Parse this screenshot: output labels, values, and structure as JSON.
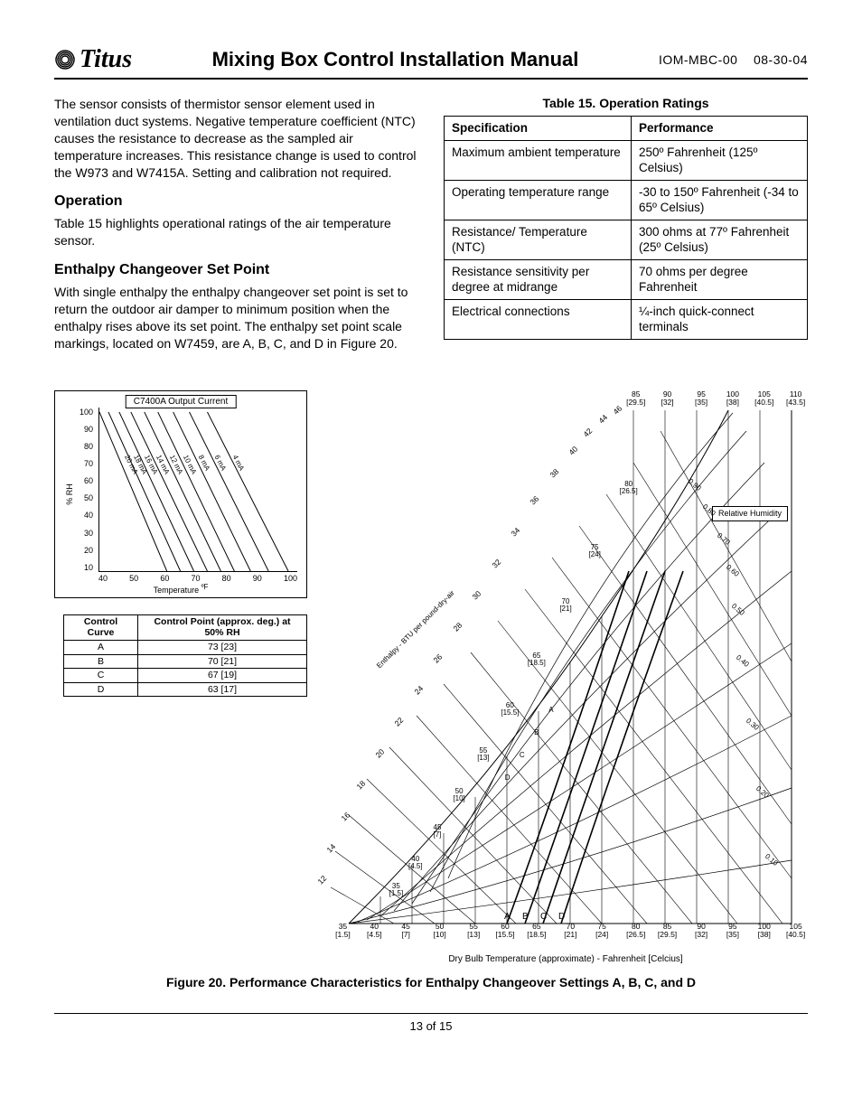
{
  "header": {
    "brand": "Titus",
    "title": "Mixing Box Control Installation Manual",
    "doc_num": "IOM-MBC-00",
    "date": "08-30-04"
  },
  "intro_para": "The sensor consists of thermistor sensor element used in ventilation duct systems. Negative temperature coefficient (NTC) causes the resistance to decrease as the sampled air temperature increases. This resistance change is used to control the W973 and W7415A. Setting and calibration not required.",
  "operation": {
    "heading": "Operation",
    "text": "Table 15 highlights operational ratings of the air temperature sensor."
  },
  "enthalpy": {
    "heading": "Enthalpy Changeover Set Point",
    "text": "With single enthalpy the enthalpy changeover set point is set to return the outdoor air damper to minimum position when the enthalpy rises above its set point. The enthalpy set point scale markings, located on W7459, are A, B, C, and D in Figure 20."
  },
  "table15": {
    "caption": "Table 15. Operation Ratings",
    "head": {
      "spec": "Specification",
      "perf": "Performance"
    },
    "rows": [
      {
        "spec": "Maximum ambient temperature",
        "perf": "250º Fahrenheit (125º Celsius)"
      },
      {
        "spec": "Operating temperature range",
        "perf": "-30 to 150º Fahrenheit (-34 to 65º Celsius)"
      },
      {
        "spec": "Resistance/ Temperature (NTC)",
        "perf": "300 ohms at 77º Fahrenheit (25º Celsius)"
      },
      {
        "spec": "Resistance sensitivity per degree at midrange",
        "perf": "70 ohms per degree Fahrenheit"
      },
      {
        "spec": "Electrical connections",
        "perf": "¼-inch quick-connect terminals"
      }
    ]
  },
  "control_curve_table": {
    "head": {
      "curve": "Control Curve",
      "point": "Control Point (approx. deg.) at 50% RH"
    },
    "rows": [
      {
        "curve": "A",
        "point": "73 [23]"
      },
      {
        "curve": "B",
        "point": "70 [21]"
      },
      {
        "curve": "C",
        "point": "67 [19]"
      },
      {
        "curve": "D",
        "point": "63 [17]"
      }
    ]
  },
  "mini_chart": {
    "title": "C7400A Output Current",
    "ylabel": "% RH",
    "xlabel": "Temperature",
    "xunit": "ºF",
    "y_ticks": [
      "100",
      "90",
      "80",
      "70",
      "60",
      "50",
      "40",
      "30",
      "20",
      "10"
    ],
    "x_ticks": [
      "40",
      "50",
      "60",
      "70",
      "80",
      "90",
      "100"
    ],
    "series_labels": [
      "20 mA",
      "18 mA",
      "16 mA",
      "14 mA",
      "12 mA",
      "10 mA",
      "8 mA",
      "6 mA",
      "4 mA"
    ]
  },
  "psych": {
    "rh_box": "Relative Humidity",
    "x_axis_label": "Dry Bulb Temperature (approximate) - Fahrenheit [Celcius]",
    "enthalpy_axis_label": "Enthalpy - BTU per pound-dry-air",
    "x_ticks": [
      {
        "f": "35",
        "c": "[1.5]"
      },
      {
        "f": "40",
        "c": "[4.5]"
      },
      {
        "f": "45",
        "c": "[7]"
      },
      {
        "f": "50",
        "c": "[10]"
      },
      {
        "f": "55",
        "c": "[13]"
      },
      {
        "f": "60",
        "c": "[15.5]"
      },
      {
        "f": "65",
        "c": "[18.5]"
      },
      {
        "f": "70",
        "c": "[21]"
      },
      {
        "f": "75",
        "c": "[24]"
      },
      {
        "f": "80",
        "c": "[26.5]"
      },
      {
        "f": "85",
        "c": "[29.5]"
      },
      {
        "f": "90",
        "c": "[32]"
      },
      {
        "f": "95",
        "c": "[35]"
      },
      {
        "f": "100",
        "c": "[38]"
      },
      {
        "f": "105",
        "c": "[40.5]"
      }
    ],
    "top_ticks": [
      {
        "f": "85",
        "c": "[29.5]"
      },
      {
        "f": "90",
        "c": "[32]"
      },
      {
        "f": "95",
        "c": "[35]"
      },
      {
        "f": "100",
        "c": "[38]"
      },
      {
        "f": "105",
        "c": "[40.5]"
      },
      {
        "f": "110",
        "c": "[43.5]"
      }
    ],
    "db_marks": [
      {
        "f": "80",
        "c": "[26.5]"
      },
      {
        "f": "75",
        "c": "[24]"
      },
      {
        "f": "70",
        "c": "[21]"
      },
      {
        "f": "65",
        "c": "[18.5]"
      },
      {
        "f": "60",
        "c": "[15.5]"
      },
      {
        "f": "55",
        "c": "[13]"
      },
      {
        "f": "50",
        "c": "[10]"
      },
      {
        "f": "45",
        "c": "[7]"
      },
      {
        "f": "40",
        "c": "[4.5]"
      },
      {
        "f": "35",
        "c": "[1.5]"
      }
    ],
    "enthalpy_ticks": [
      "12",
      "14",
      "16",
      "18",
      "20",
      "22",
      "24",
      "26",
      "28",
      "30",
      "32",
      "34",
      "36",
      "38",
      "40",
      "42",
      "44",
      "46"
    ],
    "rh_curves": [
      "0.10",
      "0.20",
      "0.30",
      "0.40",
      "0.50",
      "0.60",
      "0.70",
      "0.80",
      "0.90"
    ],
    "point_labels": [
      "A",
      "B",
      "C",
      "D"
    ]
  },
  "chart_data": [
    {
      "type": "line",
      "title": "C7400A Output Current",
      "xlabel": "Temperature ºF",
      "ylabel": "% RH",
      "xlim": [
        40,
        100
      ],
      "ylim": [
        10,
        100
      ],
      "note": "Approximate parallel iso-current lines descending from upper-left",
      "series": [
        {
          "name": "20 mA",
          "x": [
            40,
            60
          ],
          "y": [
            95,
            10
          ]
        },
        {
          "name": "18 mA",
          "x": [
            42,
            64
          ],
          "y": [
            95,
            10
          ]
        },
        {
          "name": "16 mA",
          "x": [
            45,
            68
          ],
          "y": [
            95,
            10
          ]
        },
        {
          "name": "14 mA",
          "x": [
            48,
            72
          ],
          "y": [
            95,
            10
          ]
        },
        {
          "name": "12 mA",
          "x": [
            52,
            76
          ],
          "y": [
            95,
            10
          ]
        },
        {
          "name": "10 mA",
          "x": [
            56,
            80
          ],
          "y": [
            95,
            10
          ]
        },
        {
          "name": "8 mA",
          "x": [
            60,
            85
          ],
          "y": [
            95,
            10
          ]
        },
        {
          "name": "6 mA",
          "x": [
            65,
            90
          ],
          "y": [
            95,
            10
          ]
        },
        {
          "name": "4 mA",
          "x": [
            70,
            95
          ],
          "y": [
            95,
            10
          ]
        }
      ]
    },
    {
      "type": "table",
      "title": "Control curve set points at 50% RH",
      "categories": [
        "A",
        "B",
        "C",
        "D"
      ],
      "values_F": [
        73,
        70,
        67,
        63
      ],
      "values_C": [
        23,
        21,
        19,
        17
      ]
    },
    {
      "type": "other",
      "title": "Psychrometric chart with enthalpy changeover curves A–D",
      "x_axis_F": [
        35,
        40,
        45,
        50,
        55,
        60,
        65,
        70,
        75,
        80,
        85,
        90,
        95,
        100,
        105
      ],
      "x_axis_C": [
        1.5,
        4.5,
        7,
        10,
        13,
        15.5,
        18.5,
        21,
        24,
        26.5,
        29.5,
        32,
        35,
        38,
        40.5
      ],
      "top_extension_F": [
        85,
        90,
        95,
        100,
        105,
        110
      ],
      "enthalpy_btu_per_lb": [
        12,
        14,
        16,
        18,
        20,
        22,
        24,
        26,
        28,
        30,
        32,
        34,
        36,
        38,
        40,
        42,
        44,
        46
      ],
      "relative_humidity_curves": [
        0.1,
        0.2,
        0.3,
        0.4,
        0.5,
        0.6,
        0.7,
        0.8,
        0.9
      ],
      "changeover_curves_at_50RH": {
        "A": 73,
        "B": 70,
        "C": 67,
        "D": 63
      }
    }
  ],
  "figure_caption": "Figure 20. Performance Characteristics for Enthalpy Changeover Settings A, B, C, and D",
  "footer": {
    "page": "13 of 15"
  }
}
